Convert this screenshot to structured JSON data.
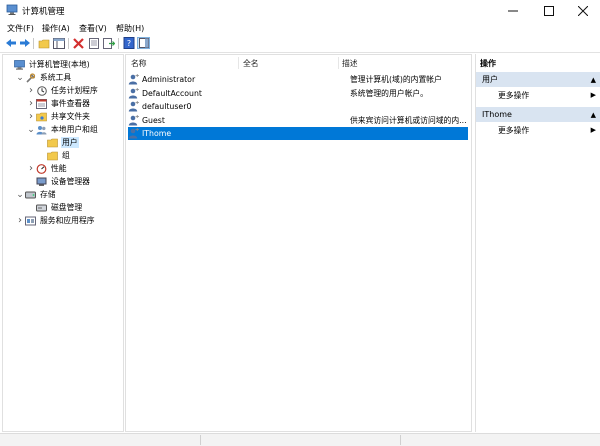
{
  "window": {
    "title": "计算机管理"
  },
  "menu": [
    "文件(F)",
    "操作(A)",
    "查看(V)",
    "帮助(H)"
  ],
  "tree": [
    {
      "label": "计算机管理(本地)",
      "level": 0,
      "expander": "",
      "icon": "computer-management-icon"
    },
    {
      "label": "系统工具",
      "level": 1,
      "expander": "v",
      "icon": "system-tools-icon"
    },
    {
      "label": "任务计划程序",
      "level": 2,
      "expander": ">",
      "icon": "task-scheduler-icon"
    },
    {
      "label": "事件查看器",
      "level": 2,
      "expander": ">",
      "icon": "event-viewer-icon"
    },
    {
      "label": "共享文件夹",
      "level": 2,
      "expander": ">",
      "icon": "shared-folder-icon"
    },
    {
      "label": "本地用户和组",
      "level": 2,
      "expander": "v",
      "icon": "local-users-groups-icon"
    },
    {
      "label": "用户",
      "level": 3,
      "expander": "",
      "icon": "folder-icon",
      "selected": true
    },
    {
      "label": "组",
      "level": 3,
      "expander": "",
      "icon": "folder-icon"
    },
    {
      "label": "性能",
      "level": 2,
      "expander": ">",
      "icon": "performance-icon"
    },
    {
      "label": "设备管理器",
      "level": 2,
      "expander": "",
      "icon": "device-manager-icon"
    },
    {
      "label": "存储",
      "level": 1,
      "expander": "v",
      "icon": "storage-icon"
    },
    {
      "label": "磁盘管理",
      "level": 2,
      "expander": "",
      "icon": "disk-management-icon"
    },
    {
      "label": "服务和应用程序",
      "level": 1,
      "expander": ">",
      "icon": "services-apps-icon"
    }
  ],
  "columns": {
    "name": "名称",
    "full": "全名",
    "desc": "描述"
  },
  "users": [
    {
      "name": "Administrator",
      "full": "",
      "desc": "管理计算机(域)的内置帐户"
    },
    {
      "name": "DefaultAccount",
      "full": "",
      "desc": "系统管理的用户帐户。"
    },
    {
      "name": "defaultuser0",
      "full": "",
      "desc": ""
    },
    {
      "name": "Guest",
      "full": "",
      "desc": "供来宾访问计算机或访问域的内..."
    },
    {
      "name": "IThome",
      "full": "",
      "desc": "",
      "selected": true
    }
  ],
  "actions": {
    "header": "操作",
    "groups": [
      {
        "title": "用户",
        "item": "更多操作"
      },
      {
        "title": "IThome",
        "item": "更多操作"
      }
    ]
  },
  "colors": {
    "selection": "#0078d7",
    "accent_header": "#d9e4f1"
  }
}
